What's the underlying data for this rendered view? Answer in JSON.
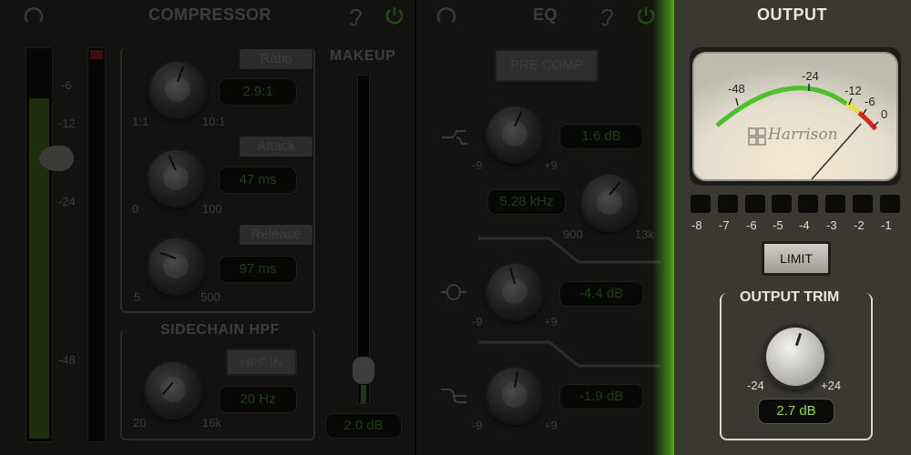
{
  "compressor": {
    "title": "COMPRESSOR",
    "meter_scale": [
      "-6",
      "-12",
      "-24",
      "-48"
    ],
    "ratio": {
      "label": "Ratio",
      "value": "2.9:1",
      "min": "1:1",
      "max": "10:1"
    },
    "attack": {
      "label": "Attack",
      "value": "47 ms",
      "min": "0",
      "max": "100"
    },
    "release": {
      "label": "Release",
      "value": "97 ms",
      "min": "5",
      "max": "500"
    },
    "makeup": {
      "label": "MAKEUP",
      "value": "2.0 dB",
      "level": 0.15
    },
    "sidechain": {
      "label": "SIDECHAIN HPF",
      "button": "HPF IN",
      "value": "20 Hz",
      "min": "20",
      "max": "16k"
    }
  },
  "eq": {
    "title": "EQ",
    "pre_comp": "PRE COMP",
    "band1": {
      "value": "1.6 dB",
      "min": "-9",
      "max": "+9"
    },
    "freq": {
      "value": "5.28 kHz",
      "min": "900",
      "max": "13k"
    },
    "band2": {
      "value": "-4.4 dB",
      "min": "-9",
      "max": "+9"
    },
    "band3": {
      "value": "-1.9 dB",
      "min": "-9",
      "max": "+9"
    }
  },
  "output": {
    "title": "OUTPUT",
    "vu_scale": [
      "-48",
      "-24",
      "-12",
      "-6",
      "0"
    ],
    "vu_brand": "Harrison",
    "limit_leds": [
      "-8",
      "-7",
      "-6",
      "-5",
      "-4",
      "-3",
      "-2",
      "-1"
    ],
    "limit": "LIMIT",
    "trim": {
      "label": "OUTPUT TRIM",
      "min": "-24",
      "max": "+24",
      "value": "2.7 dB"
    }
  },
  "colors": {
    "accent_green": "#5ec71e",
    "value_green": "#8de03a",
    "vu_red": "#d8261d",
    "vu_yellow": "#e7e12d"
  }
}
